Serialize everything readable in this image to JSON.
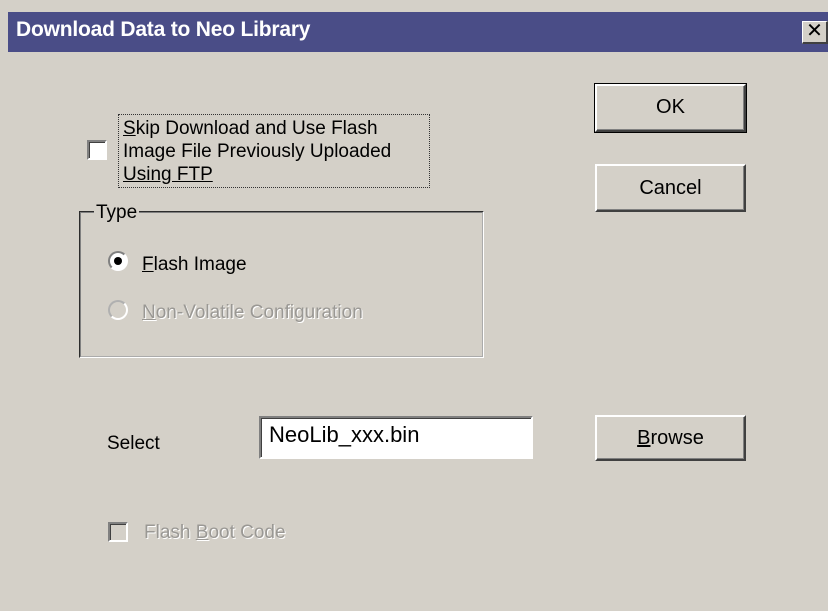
{
  "window": {
    "title": "Download Data to Neo Library",
    "close_glyph": "✕"
  },
  "buttons": {
    "ok": "OK",
    "cancel": "Cancel",
    "browse_mnemonic": "B",
    "browse_rest": "rowse"
  },
  "skip_option": {
    "checked": false,
    "line1_mnemonic": "S",
    "line1_rest": "kip Download and Use Flash",
    "line2": "Image File Previously Uploaded",
    "line3": "Using FTP"
  },
  "type_group": {
    "legend": "Type",
    "options": [
      {
        "mnemonic": "F",
        "rest": "lash Image",
        "selected": true,
        "enabled": true
      },
      {
        "mnemonic": "N",
        "rest": "on-Volatile Configuration",
        "selected": false,
        "enabled": false
      }
    ]
  },
  "select": {
    "label": "Select",
    "value": "NeoLib_xxx.bin"
  },
  "flash_boot": {
    "prefix": "Flash ",
    "mnemonic": "B",
    "rest": "oot Code",
    "checked": false,
    "enabled": false
  },
  "colors": {
    "titlebar": "#4a4d87",
    "face": "#d4d0c8",
    "disabled_text": "#9a9894"
  }
}
